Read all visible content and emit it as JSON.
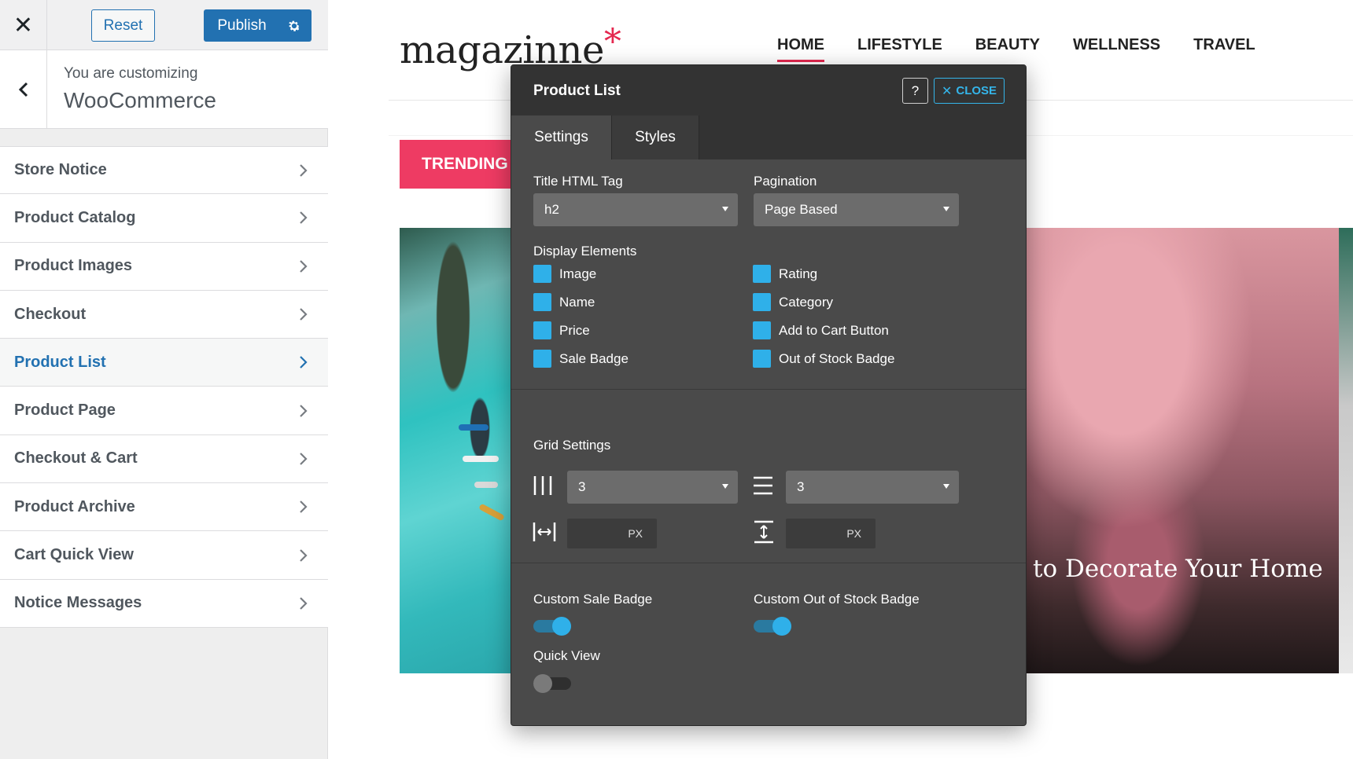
{
  "customizer": {
    "close_icon": "close-icon",
    "reset_label": "Reset",
    "publish_label": "Publish",
    "publish_settings_icon": "gear-icon",
    "back_icon": "chevron-left-icon",
    "breadcrumb_prefix": "You are customizing",
    "breadcrumb_title": "WooCommerce",
    "accent_color": "#2271b1",
    "sections": [
      {
        "label": "Store Notice",
        "active": false
      },
      {
        "label": "Product Catalog",
        "active": false
      },
      {
        "label": "Product Images",
        "active": false
      },
      {
        "label": "Checkout",
        "active": false
      },
      {
        "label": "Product List",
        "active": true
      },
      {
        "label": "Product Page",
        "active": false
      },
      {
        "label": "Checkout & Cart",
        "active": false
      },
      {
        "label": "Product Archive",
        "active": false
      },
      {
        "label": "Cart Quick View",
        "active": false
      },
      {
        "label": "Notice Messages",
        "active": false
      }
    ]
  },
  "site": {
    "logo_text": "magazinne",
    "logo_mark": "*",
    "brand_color": "#e4284f",
    "nav": [
      {
        "label": "HOME",
        "active": true
      },
      {
        "label": "LIFESTYLE",
        "active": false
      },
      {
        "label": "BEAUTY",
        "active": false
      },
      {
        "label": "WELLNESS",
        "active": false
      },
      {
        "label": "TRAVEL",
        "active": false
      }
    ],
    "trending_label": "TRENDING",
    "featured_caption": "to Decorate Your Home"
  },
  "modal": {
    "title": "Product List",
    "help_label": "?",
    "close_label": "CLOSE",
    "close_icon": "close-icon",
    "accent_color": "#2fb0e9",
    "tabs": [
      {
        "label": "Settings",
        "active": true
      },
      {
        "label": "Styles",
        "active": false
      }
    ],
    "title_tag_label": "Title HTML Tag",
    "title_tag_value": "h2",
    "pagination_label": "Pagination",
    "pagination_value": "Page Based",
    "display_elements_label": "Display Elements",
    "display_elements": [
      {
        "label": "Image",
        "checked": true
      },
      {
        "label": "Rating",
        "checked": true
      },
      {
        "label": "Name",
        "checked": true
      },
      {
        "label": "Category",
        "checked": true
      },
      {
        "label": "Price",
        "checked": true
      },
      {
        "label": "Add to Cart Button",
        "checked": true
      },
      {
        "label": "Sale Badge",
        "checked": true
      },
      {
        "label": "Out of Stock Badge",
        "checked": true
      }
    ],
    "grid_label": "Grid Settings",
    "columns_icon": "columns-icon",
    "columns_value": "3",
    "rows_icon": "rows-icon",
    "rows_value": "3",
    "column_gap_icon": "horizontal-spacing-icon",
    "column_gap_unit": "PX",
    "row_gap_icon": "vertical-spacing-icon",
    "row_gap_unit": "PX",
    "custom_sale_badge_label": "Custom Sale Badge",
    "custom_sale_badge_on": true,
    "custom_out_of_stock_label": "Custom Out of Stock Badge",
    "custom_out_of_stock_on": true,
    "quick_view_label": "Quick View",
    "quick_view_on": false
  }
}
